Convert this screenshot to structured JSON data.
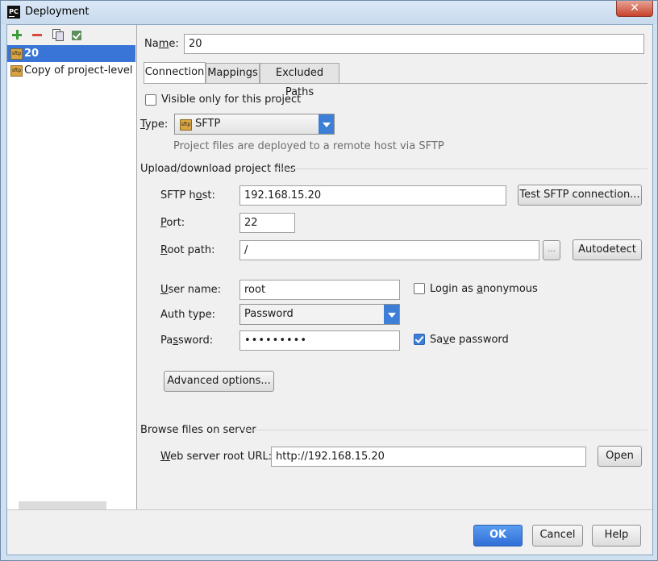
{
  "window": {
    "app_icon_text": "PC",
    "title": "Deployment",
    "close_glyph": "✕"
  },
  "toolbar": {
    "icons": [
      "add-icon",
      "remove-icon",
      "copy-icon",
      "use-as-default-icon"
    ]
  },
  "servers": [
    {
      "name": "20",
      "icon_text": "sftp",
      "selected": true
    },
    {
      "name": "Copy of project-level se",
      "icon_text": "sftp",
      "selected": false
    }
  ],
  "name": {
    "label_pre": "Na",
    "label_mn": "m",
    "label_post": "e:",
    "value": "20"
  },
  "tabs": [
    "Connection",
    "Mappings",
    "Excluded Paths"
  ],
  "visible_only": {
    "label": "Visible only for this project",
    "checked": false
  },
  "type": {
    "label_mn": "T",
    "label_post": "ype:",
    "icon_text": "sftp",
    "value": "SFTP",
    "hint": "Project files are deployed to a remote host via SFTP"
  },
  "upload_section": "Upload/download project files",
  "sftp_host": {
    "label_pre": "SFTP h",
    "label_mn": "o",
    "label_post": "st:",
    "value": "192.168.15.20",
    "test_button": "Test SFTP connection..."
  },
  "port": {
    "label_mn": "P",
    "label_post": "ort:",
    "value": "22"
  },
  "root_path": {
    "label_mn": "R",
    "label_post": "oot path:",
    "value": "/",
    "browse": "...",
    "autodetect": "Autodetect"
  },
  "user_name": {
    "label_mn": "U",
    "label_post": "ser name:",
    "value": "root"
  },
  "anonymous": {
    "label_pre": "Login as ",
    "label_mn": "a",
    "label_post": "nonymous",
    "checked": false
  },
  "auth_type": {
    "label": "Auth type:",
    "value": "Password"
  },
  "password": {
    "label_pre": "Pa",
    "label_mn": "s",
    "label_post": "sword:",
    "value": "•••••••••"
  },
  "save_password": {
    "label_pre": "Sa",
    "label_mn": "v",
    "label_post": "e password",
    "checked": true
  },
  "advanced_button": "Advanced options...",
  "browse_section": "Browse files on server",
  "web_root": {
    "label_mn": "W",
    "label_post": "eb server root URL:",
    "value": "http://192.168.15.20",
    "open_button": "Open"
  },
  "footer": {
    "ok": "OK",
    "cancel": "Cancel",
    "help": "Help"
  },
  "colors": {
    "accent": "#3875d7",
    "selection": "#3875d7",
    "close": "#c7422c"
  }
}
